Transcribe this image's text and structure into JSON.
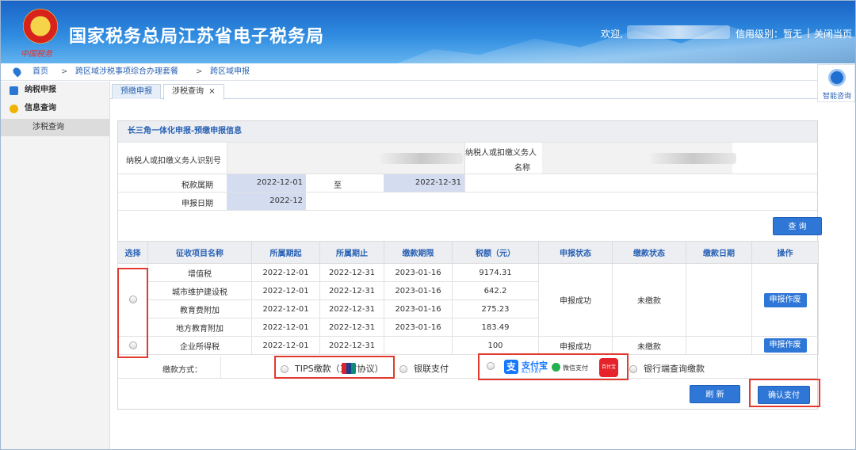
{
  "header": {
    "title": "国家税务总局江苏省电子税务局",
    "logo_sub": "中国税务",
    "welcome": "欢迎,",
    "credit": "信用级别：暂无",
    "separator": "|",
    "close_page": "关闭当页"
  },
  "breadcrumb": {
    "items": [
      "首页",
      "跨区域涉税事项综合办理套餐",
      "跨区域申报"
    ],
    "separator": ">"
  },
  "assistant": {
    "label": "智能咨询"
  },
  "sidebar": {
    "items": [
      {
        "label": "纳税申报",
        "icon": "grid-icon",
        "color": "#2a78d4"
      },
      {
        "label": "信息查询",
        "icon": "chat-icon",
        "color": "#f0b400"
      }
    ],
    "sub_item": "涉税查询"
  },
  "tabs": [
    {
      "label": "预缴申报",
      "active": false
    },
    {
      "label": "涉税查询",
      "active": true,
      "close": "×"
    }
  ],
  "panel": {
    "title": "长三角一体化申报-预缴申报信息",
    "taxpayer_id_label": "纳税人或扣缴义务人识别号",
    "taxpayer_name_label_1": "纳税人或扣缴义务人",
    "taxpayer_name_label_2": "名称",
    "period_label": "税款属期",
    "period_start": "2022-12-01",
    "period_to": "至",
    "period_end": "2022-12-31",
    "declare_date_label": "申报日期",
    "declare_date": "2022-12",
    "query_button": "查 询"
  },
  "table": {
    "headers": [
      "选择",
      "征收项目名称",
      "所属期起",
      "所属期止",
      "缴款期限",
      "税额（元）",
      "申报状态",
      "缴款状态",
      "缴款日期",
      "操作"
    ],
    "rows": [
      {
        "name": "增值税",
        "start": "2022-12-01",
        "end": "2022-12-31",
        "deadline": "2023-01-16",
        "amount": "9174.31"
      },
      {
        "name": "城市维护建设税",
        "start": "2022-12-01",
        "end": "2022-12-31",
        "deadline": "2023-01-16",
        "amount": "642.2"
      },
      {
        "name": "教育费附加",
        "start": "2022-12-01",
        "end": "2022-12-31",
        "deadline": "2023-01-16",
        "amount": "275.23"
      },
      {
        "name": "地方教育附加",
        "start": "2022-12-01",
        "end": "2022-12-31",
        "deadline": "2023-01-16",
        "amount": "183.49"
      },
      {
        "name": "企业所得税",
        "start": "2022-12-01",
        "end": "2022-12-31",
        "deadline": "",
        "amount": "100"
      }
    ],
    "group1": {
      "declare_status": "申报成功",
      "pay_status": "未缴款",
      "action": "申报作废"
    },
    "group2": {
      "declare_status": "申报成功",
      "pay_status": "未缴款",
      "action": "申报作废"
    }
  },
  "payment": {
    "label": "缴款方式：",
    "tips": "TIPS缴款（三方协议）",
    "unionpay": "银联支付",
    "alipay": "支付宝",
    "alipay_en": "ALIPAY",
    "wechat": "微信支付",
    "baidu": "百付宝",
    "bank_query": "银行端查询缴款"
  },
  "buttons": {
    "refresh": "刷 新",
    "confirm": "确认支付"
  },
  "colors": {
    "accent": "#2f77d6",
    "highlight": "#e23a2f",
    "unpaid": "#e02020"
  }
}
